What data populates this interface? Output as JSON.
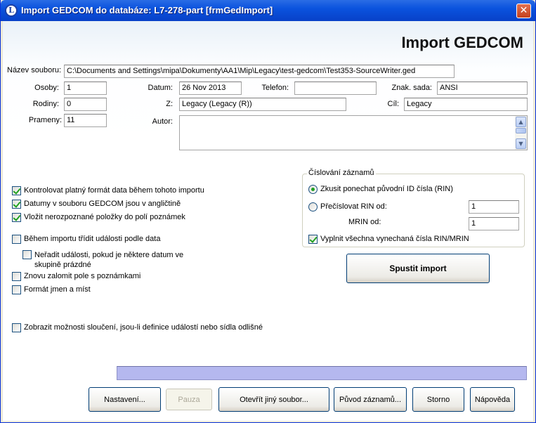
{
  "window": {
    "title": "Import GEDCOM do databáze: L7-278-part [frmGedImport]",
    "close_label": "✕"
  },
  "heading": "Import GEDCOM",
  "file": {
    "label": "Název souboru:",
    "value": "C:\\Documents and Settings\\mipa\\Dokumenty\\AA1\\Mip\\Legacy\\test-gedcom\\Test353-SourceWriter.ged"
  },
  "stats": {
    "persons_label": "Osoby:",
    "persons": "1",
    "families_label": "Rodiny:",
    "families": "0",
    "sources_label": "Prameny:",
    "sources": "11"
  },
  "info": {
    "date_label": "Datum:",
    "date": "26 Nov 2013",
    "phone_label": "Telefon:",
    "phone": "",
    "charset_label": "Znak. sada:",
    "charset": "ANSI",
    "from_label": "Z:",
    "from": "Legacy (Legacy (R))",
    "to_label": "Cíl:",
    "to": "Legacy",
    "author_label": "Autor:",
    "author": ""
  },
  "options": [
    {
      "label": "Kontrolovat platný formát data během tohoto importu",
      "checked": true
    },
    {
      "label": "Datumy v souboru GEDCOM jsou v angličtině",
      "checked": true
    },
    {
      "label": "Vložit nerozpoznané položky do polí poznámek",
      "checked": true
    },
    {
      "label": "Během importu třídit události podle data",
      "checked": false
    },
    {
      "label": "Neřadit události, pokud je některe datum ve skupině prázdné",
      "checked": false
    },
    {
      "label": "Znovu zalomit pole s poznámkami",
      "checked": false
    },
    {
      "label": "Formát jmen a míst",
      "checked": false
    },
    {
      "label": "Zobrazit možnosti sloučení, jsou-li definice událostí nebo sídla odlišné",
      "checked": false
    }
  ],
  "numbering": {
    "title": "Číslování záznamů",
    "keep_label": "Zkusit ponechat původní ID čísla (RIN)",
    "keep_selected": true,
    "renumber_label": "Přečíslovat RIN od:",
    "renumber_selected": false,
    "rin_from": "1",
    "mrin_label": "MRIN od:",
    "mrin_from": "1",
    "fill_label": "Vyplnit všechna vynechaná čísla RIN/MRIN",
    "fill_checked": true
  },
  "start_button": "Spustit import",
  "progress": 1.0,
  "buttons": {
    "settings": "Nastavení...",
    "pause": "Pauza",
    "open_other": "Otevřít jiný soubor...",
    "record_source": "Původ záznamů...",
    "cancel": "Storno",
    "help": "Nápověda"
  }
}
